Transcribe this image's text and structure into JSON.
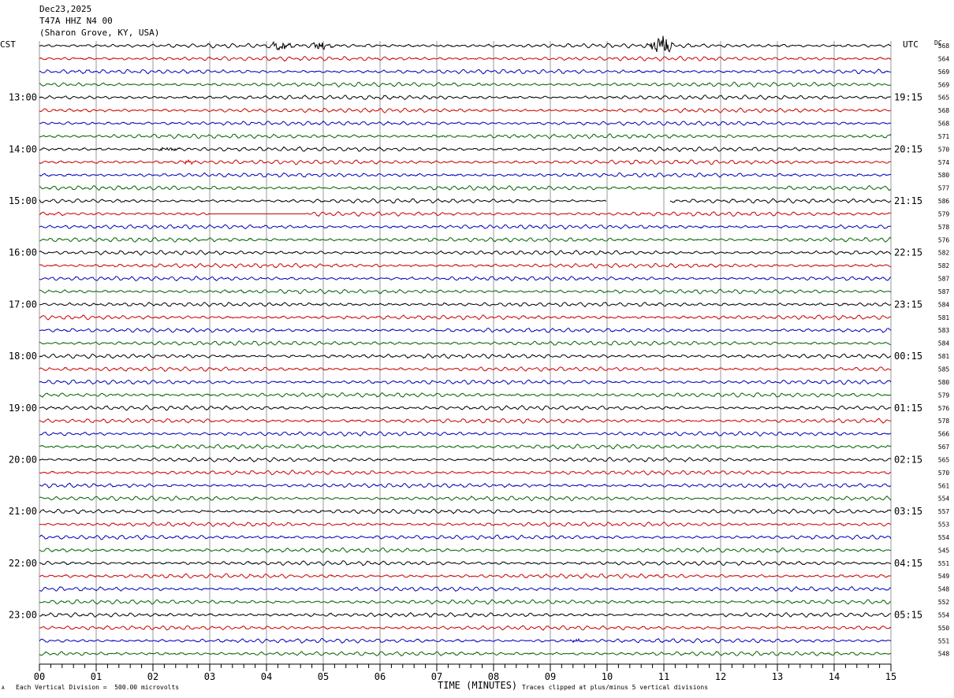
{
  "header": {
    "date": "Dec23,2025",
    "station": "T47A HHZ N4 00",
    "location": "(Sharon Grove, KY, USA)"
  },
  "left_tz": "CST",
  "right_tz": "UTC",
  "dc_label": "DC",
  "footer": {
    "scale_note": "Each Vertical Division =  500.00 microvolts",
    "x_title": "TIME (MINUTES)",
    "clip_note": "Traces clipped at plus/minus 5 vertical divisions",
    "corner_mark": "A"
  },
  "colors": {
    "trace_cycle": [
      "#000000",
      "#cc0000",
      "#0000bb",
      "#006400"
    ],
    "grid": "#000000"
  },
  "chart_data": {
    "type": "line",
    "subtype": "helicorder",
    "x_unit": "minutes",
    "xlim": [
      0,
      15
    ],
    "x_ticks": [
      "00",
      "01",
      "02",
      "03",
      "04",
      "05",
      "06",
      "07",
      "08",
      "09",
      "10",
      "11",
      "12",
      "13",
      "14",
      "15"
    ],
    "row_count": 48,
    "minutes_per_row": 15,
    "left_hour_labels": [
      {
        "row": 4,
        "text": "13:00"
      },
      {
        "row": 8,
        "text": "14:00"
      },
      {
        "row": 12,
        "text": "15:00"
      },
      {
        "row": 16,
        "text": "16:00"
      },
      {
        "row": 20,
        "text": "17:00"
      },
      {
        "row": 24,
        "text": "18:00"
      },
      {
        "row": 28,
        "text": "19:00"
      },
      {
        "row": 32,
        "text": "20:00"
      },
      {
        "row": 36,
        "text": "21:00"
      },
      {
        "row": 40,
        "text": "22:00"
      },
      {
        "row": 44,
        "text": "23:00"
      }
    ],
    "right_hour_labels": [
      {
        "row": 4,
        "text": "19:15"
      },
      {
        "row": 8,
        "text": "20:15"
      },
      {
        "row": 12,
        "text": "21:15"
      },
      {
        "row": 16,
        "text": "22:15"
      },
      {
        "row": 20,
        "text": "23:15"
      },
      {
        "row": 24,
        "text": "00:15"
      },
      {
        "row": 28,
        "text": "01:15"
      },
      {
        "row": 32,
        "text": "02:15"
      },
      {
        "row": 36,
        "text": "03:15"
      },
      {
        "row": 40,
        "text": "04:15"
      },
      {
        "row": 44,
        "text": "05:15"
      }
    ],
    "dc_offsets": [
      568,
      564,
      569,
      569,
      565,
      568,
      568,
      571,
      570,
      574,
      580,
      577,
      586,
      579,
      578,
      576,
      582,
      582,
      587,
      587,
      584,
      581,
      583,
      584,
      581,
      585,
      580,
      579,
      576,
      578,
      566,
      567,
      565,
      570,
      561,
      554,
      557,
      553,
      554,
      545,
      551,
      549,
      548,
      552,
      554,
      550,
      551,
      548
    ],
    "events": [
      {
        "row": 0,
        "start_min": 4.0,
        "end_min": 4.5,
        "amp": 5
      },
      {
        "row": 0,
        "start_min": 4.75,
        "end_min": 5.2,
        "amp": 5
      },
      {
        "row": 0,
        "start_min": 10.7,
        "end_min": 11.2,
        "amp": 14
      },
      {
        "row": 8,
        "start_min": 2.0,
        "end_min": 2.5,
        "amp": 3
      },
      {
        "row": 9,
        "start_min": 2.5,
        "end_min": 2.8,
        "amp": 3
      },
      {
        "row": 46,
        "start_min": 9.3,
        "end_min": 9.6,
        "amp": 3
      }
    ],
    "gaps": [
      {
        "row": 12,
        "start_min": 10.0,
        "end_min": 11.1
      },
      {
        "row": 13,
        "start_min": 3.0,
        "end_min": 4.7,
        "flat": true
      }
    ]
  }
}
